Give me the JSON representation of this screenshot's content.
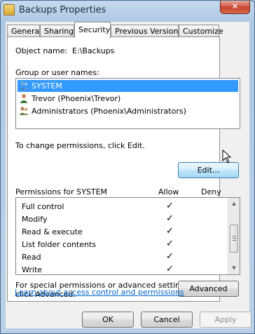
{
  "window": {
    "title": "Backups Properties",
    "close_label": "✕"
  },
  "tabs": [
    {
      "label": "General"
    },
    {
      "label": "Sharing"
    },
    {
      "label": "Security"
    },
    {
      "label": "Previous Versions"
    },
    {
      "label": "Customize"
    }
  ],
  "security": {
    "object_name_label": "Object name:",
    "object_name_value": "E:\\Backups",
    "group_label": "Group or user names:",
    "users": [
      {
        "label": "SYSTEM",
        "icon": "users-group-icon"
      },
      {
        "label": "Trevor (Phoenix\\Trevor)",
        "icon": "user-icon"
      },
      {
        "label": "Administrators (Phoenix\\Administrators)",
        "icon": "users-group-icon"
      }
    ],
    "change_hint": "To change permissions, click Edit.",
    "edit_label": "Edit...",
    "permissions_header": "Permissions for SYSTEM",
    "allow_header": "Allow",
    "deny_header": "Deny",
    "permissions": [
      {
        "name": "Full control",
        "allow": "✓"
      },
      {
        "name": "Modify",
        "allow": "✓"
      },
      {
        "name": "Read & execute",
        "allow": "✓"
      },
      {
        "name": "List folder contents",
        "allow": "✓"
      },
      {
        "name": "Read",
        "allow": "✓"
      },
      {
        "name": "Write",
        "allow": "✓"
      }
    ],
    "advanced_hint_line1": "For special permissions or advanced settings,",
    "advanced_hint_line2": "click Advanced.",
    "advanced_label": "Advanced",
    "learn_link": "Learn about access control and permissions"
  },
  "footer": {
    "ok_label": "OK",
    "cancel_label": "Cancel",
    "apply_label": "Apply"
  },
  "colors": {
    "selection": "#3399ff",
    "link": "#0066cc"
  }
}
